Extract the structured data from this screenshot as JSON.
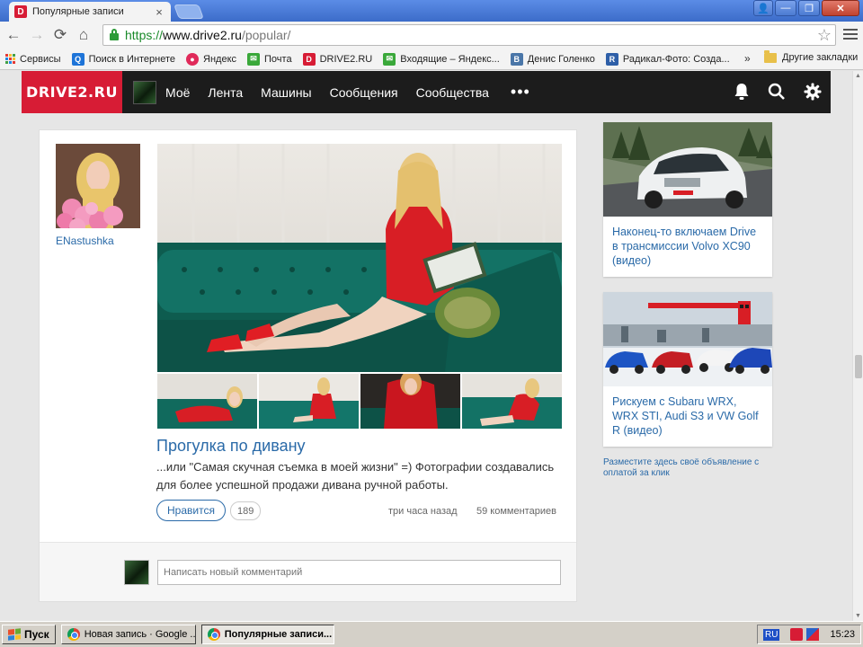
{
  "browser": {
    "tab_title": "Популярные записи",
    "tab_favicon": "D",
    "tab_close": "×",
    "url_scheme": "https://",
    "url_host": "www.drive2.ru",
    "url_path": "/popular/",
    "window_buttons": {
      "user": "👤",
      "minimize": "—",
      "restore": "❐",
      "close": "✕"
    },
    "nav": {
      "back": "←",
      "forward": "→",
      "reload": "⟳",
      "home": "⌂"
    },
    "star": "☆"
  },
  "bookmarks": {
    "items": [
      {
        "label": "Сервисы",
        "icon": "apps-icon"
      },
      {
        "label": "Поиск в Интернете",
        "icon": "search-icon",
        "color": "#1e74d8",
        "glyph": "Q"
      },
      {
        "label": "Яндекс",
        "icon": "yandex-icon",
        "color": "#e02a5a",
        "glyph": "●"
      },
      {
        "label": "Почта",
        "icon": "mail-icon",
        "color": "#3aa83a",
        "glyph": "✉"
      },
      {
        "label": "DRIVE2.RU",
        "icon": "drive2-icon",
        "color": "#d71c35",
        "glyph": "D"
      },
      {
        "label": "Входящие – Яндекс...",
        "icon": "mail-icon",
        "color": "#3aa83a",
        "glyph": "✉"
      },
      {
        "label": "Денис Голенко",
        "icon": "vk-icon",
        "color": "#4a76a8",
        "glyph": "B"
      },
      {
        "label": "Радикал-Фото: Созда...",
        "icon": "radikal-icon",
        "color": "#2e5fa8",
        "glyph": "R"
      }
    ],
    "more": "»",
    "other_folder": "Другие закладки"
  },
  "site": {
    "logo": "DRIVE2.RU",
    "nav": [
      "Моё",
      "Лента",
      "Машины",
      "Сообщения",
      "Сообщества"
    ],
    "nav_more": "•••",
    "ghost_tooltip": "Написать новый комментарий"
  },
  "post": {
    "author": "ENastushka",
    "title": "Прогулка по дивану",
    "excerpt": "...или \"Самая скучная съемка в моей жизни\" =) Фотографии создавались для более успешной продажи дивана ручной работы.",
    "like_label": "Нравится",
    "like_count": "189",
    "time": "три часа назад",
    "comments": "59 комментариев",
    "comment_placeholder": "Написать новый комментарий"
  },
  "sidebar": {
    "ads": [
      {
        "text": "Наконец-то включаем Drive в трансмиссии Volvo XC90 (видео)"
      },
      {
        "text": "Рискуем с Subaru WRX, WRX STI, Audi S3 и VW Golf R (видео)"
      }
    ],
    "promo": "Разместите здесь своё объявление с оплатой за клик"
  },
  "taskbar": {
    "start": "Пуск",
    "tasks": [
      {
        "label": "Новая запись · Google ...",
        "active": false
      },
      {
        "label": "Популярные записи...",
        "active": true
      }
    ],
    "lang": "RU",
    "clock": "15:23"
  },
  "colors": {
    "brand": "#d71c35",
    "link": "#2a6aa8",
    "header_bg": "#1c1c1c"
  }
}
